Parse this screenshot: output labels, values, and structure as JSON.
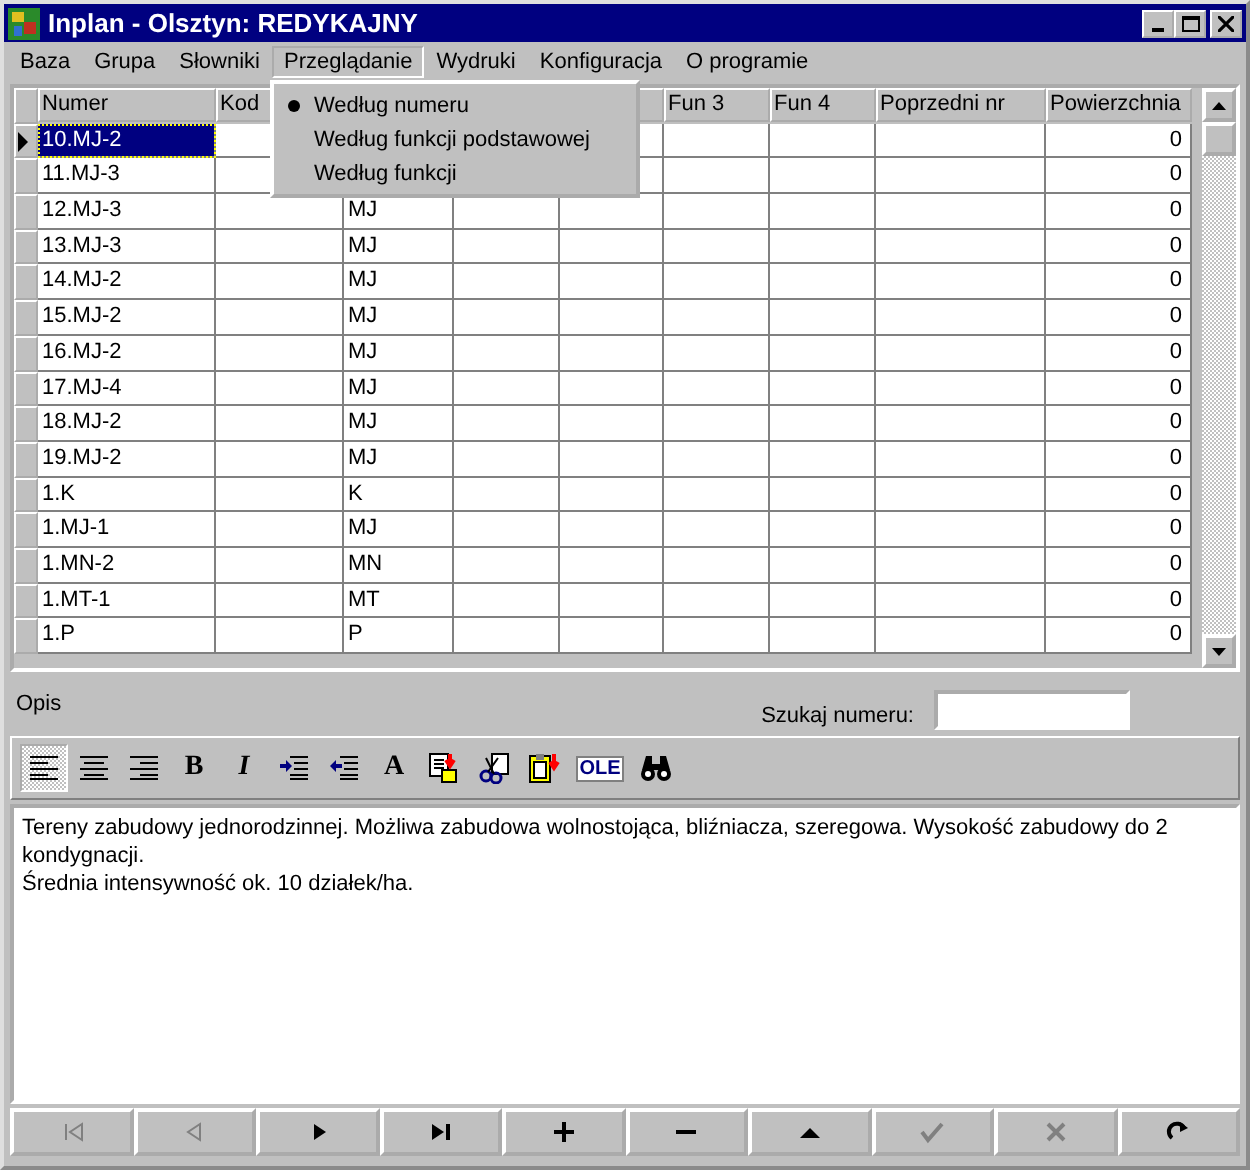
{
  "window": {
    "title": "Inplan - Olsztyn: REDYKAJNY"
  },
  "menu": [
    {
      "label": "Baza",
      "selected": false
    },
    {
      "label": "Grupa",
      "selected": false
    },
    {
      "label": "Słowniki",
      "selected": false
    },
    {
      "label": "Przeglądanie",
      "selected": true
    },
    {
      "label": "Wydruki",
      "selected": false
    },
    {
      "label": "Konfiguracja",
      "selected": false
    },
    {
      "label": "O programie",
      "selected": false
    }
  ],
  "dropdown": [
    {
      "label": "Według numeru",
      "checked": true
    },
    {
      "label": "Według funkcji podstawowej",
      "checked": false
    },
    {
      "label": "Według funkcji",
      "checked": false
    }
  ],
  "table": {
    "columns": [
      "Numer",
      "Kod",
      "",
      "",
      "",
      "Fun 3",
      "Fun 4",
      "Poprzedni nr",
      "Powierzchnia"
    ],
    "rows": [
      {
        "numer": "10.MJ-2",
        "powierzchnia": "0",
        "selected": true
      },
      {
        "numer": "11.MJ-3",
        "powierzchnia": "0",
        "selected": false
      },
      {
        "numer": "12.MJ-3",
        "column_3": "MJ",
        "powierzchnia": "0",
        "selected": false
      },
      {
        "numer": "13.MJ-3",
        "column_3": "MJ",
        "powierzchnia": "0",
        "selected": false
      },
      {
        "numer": "14.MJ-2",
        "column_3": "MJ",
        "powierzchnia": "0",
        "selected": false
      },
      {
        "numer": "15.MJ-2",
        "column_3": "MJ",
        "powierzchnia": "0",
        "selected": false
      },
      {
        "numer": "16.MJ-2",
        "column_3": "MJ",
        "powierzchnia": "0",
        "selected": false
      },
      {
        "numer": "17.MJ-4",
        "column_3": "MJ",
        "powierzchnia": "0",
        "selected": false
      },
      {
        "numer": "18.MJ-2",
        "column_3": "MJ",
        "powierzchnia": "0",
        "selected": false
      },
      {
        "numer": "19.MJ-2",
        "column_3": "MJ",
        "powierzchnia": "0",
        "selected": false
      },
      {
        "numer": "1.K",
        "column_3": "K",
        "powierzchnia": "0",
        "selected": false
      },
      {
        "numer": "1.MJ-1",
        "column_3": "MJ",
        "powierzchnia": "0",
        "selected": false
      },
      {
        "numer": "1.MN-2",
        "column_3": "MN",
        "powierzchnia": "0",
        "selected": false
      },
      {
        "numer": "1.MT-1",
        "column_3": "MT",
        "powierzchnia": "0",
        "selected": false
      },
      {
        "numer": "1.P",
        "column_3": "P",
        "powierzchnia": "0",
        "selected": false
      }
    ]
  },
  "description": {
    "label": "Opis",
    "search_label": "Szukaj numeru:"
  },
  "toolbar": [
    {
      "kind": "align-left",
      "pressed": true
    },
    {
      "kind": "align-center",
      "pressed": false
    },
    {
      "kind": "align-right",
      "pressed": false
    },
    {
      "kind": "bold",
      "label": "B",
      "pressed": false
    },
    {
      "kind": "italic",
      "label": "I",
      "pressed": false
    },
    {
      "kind": "indent",
      "pressed": false
    },
    {
      "kind": "outdent",
      "pressed": false
    },
    {
      "kind": "font",
      "label": "A",
      "pressed": false
    },
    {
      "kind": "paste",
      "pressed": false
    },
    {
      "kind": "cut",
      "pressed": false
    },
    {
      "kind": "clipboard",
      "pressed": false
    },
    {
      "kind": "ole",
      "label": "OLE",
      "pressed": false
    },
    {
      "kind": "find",
      "pressed": false
    }
  ],
  "memo": [
    "Tereny zabudowy jednorodzinnej. Możliwa zabudowa wolnostojąca, bliźniacza, szeregowa. Wysokość zabudowy do 2 kondygnacji.",
    "Średnia intensywność ok. 10 działek/ha."
  ],
  "navigator": [
    {
      "kind": "first",
      "disabled": true
    },
    {
      "kind": "prior",
      "disabled": true
    },
    {
      "kind": "next",
      "disabled": false
    },
    {
      "kind": "last",
      "disabled": false
    },
    {
      "kind": "insert",
      "disabled": false
    },
    {
      "kind": "delete",
      "disabled": false
    },
    {
      "kind": "edit",
      "disabled": false
    },
    {
      "kind": "post",
      "disabled": true
    },
    {
      "kind": "cancel",
      "disabled": true
    },
    {
      "kind": "refresh",
      "disabled": false
    }
  ]
}
